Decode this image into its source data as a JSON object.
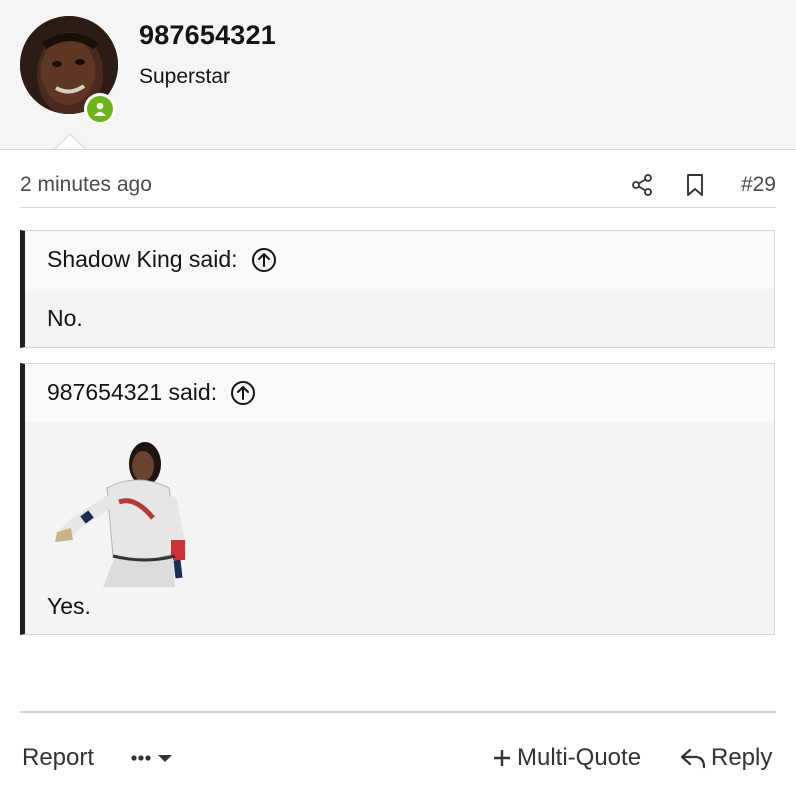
{
  "user": {
    "name": "987654321",
    "title": "Superstar"
  },
  "post": {
    "time": "2 minutes ago",
    "number": "#29"
  },
  "quotes": [
    {
      "author_said": "Shadow King said:",
      "text": "No."
    },
    {
      "author_said": "987654321 said:",
      "text": "Yes."
    }
  ],
  "footer": {
    "report": "Report",
    "multi_quote": "Multi-Quote",
    "reply": "Reply"
  },
  "icons": {
    "online": "user-online-icon",
    "share": "share-icon",
    "bookmark": "bookmark-icon",
    "jump": "arrow-up-circle-icon",
    "more": "ellipsis-icon",
    "dropdown": "caret-down-icon",
    "multiquote": "plus-icon",
    "reply": "reply-arrow-icon"
  },
  "colors": {
    "header_bg": "#f5f5f5",
    "online_badge": "#6ab619",
    "quote_bar": "#1f1f1f",
    "quote_bg": "#f4f4f4"
  }
}
